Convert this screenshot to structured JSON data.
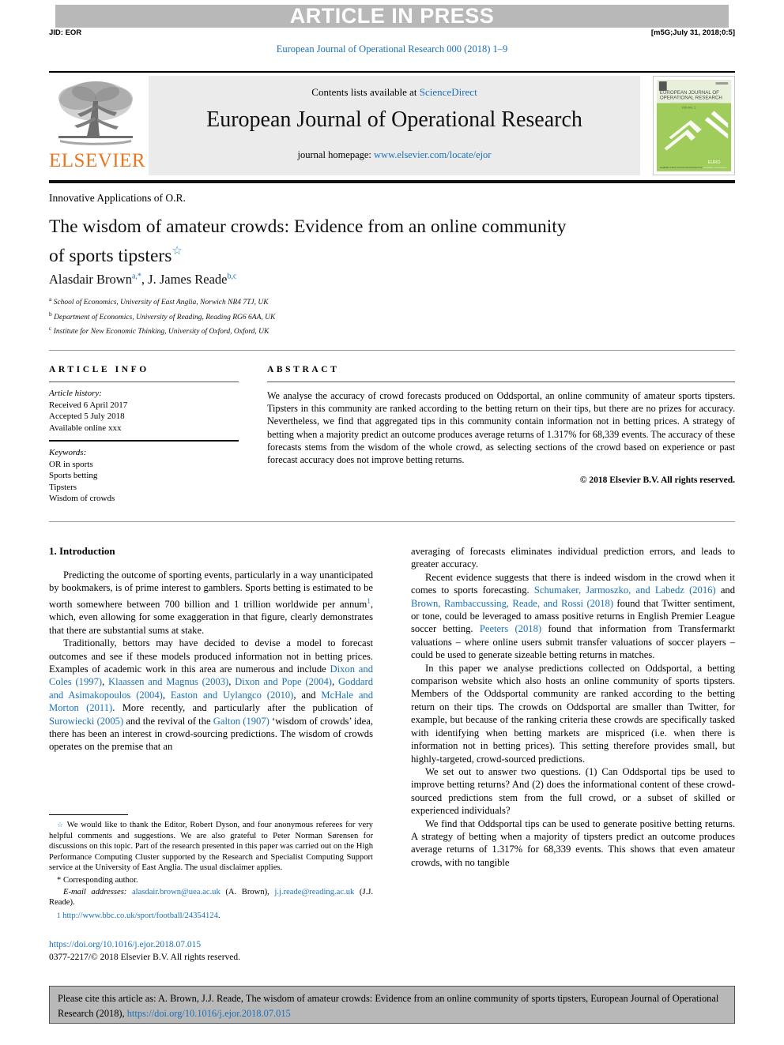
{
  "banner": {
    "text": "ARTICLE IN PRESS"
  },
  "marker": {
    "jid": "JID: EOR",
    "tag": "[m5G;July 31, 2018;0:5]"
  },
  "running_head": "European Journal of Operational Research 000 (2018) 1–9",
  "masthead": {
    "contents_prefix": "Contents lists available at ",
    "contents_link": "ScienceDirect",
    "journal_title": "European Journal of Operational Research",
    "homepage_prefix": "journal homepage: ",
    "homepage_url": "www.elsevier.com/locate/ejor",
    "publisher_wordmark": "ELSEVIER",
    "cover_title_line1": "EUROPEAN JOURNAL OF",
    "cover_title_line2": "OPERATIONAL RESEARCH",
    "cover_volume": "Volume 1",
    "cover_footer": "EURO"
  },
  "article": {
    "kicker": "Innovative Applications of O.R.",
    "title_line1": "The wisdom of amateur crowds: Evidence from an online community",
    "title_line2": "of sports tipsters",
    "title_star": "☆",
    "authors_html": "Alasdair Brown",
    "author1": "Alasdair Brown",
    "author1_sup": "a,*",
    "author2": "J. James Reade",
    "author2_sup": "b,c",
    "affiliations": [
      {
        "mark": "a",
        "text": "School of Economics, University of East Anglia, Norwich NR4 7TJ, UK"
      },
      {
        "mark": "b",
        "text": "Department of Economics, University of Reading, Reading RG6 6AA, UK"
      },
      {
        "mark": "c",
        "text": "Institute for New Economic Thinking, University of Oxford, Oxford, UK"
      }
    ]
  },
  "article_info": {
    "heading": "ARTICLE INFO",
    "history_label": "Article history:",
    "history": [
      "Received 6 April 2017",
      "Accepted 5 July 2018",
      "Available online xxx"
    ],
    "keywords_label": "Keywords:",
    "keywords": [
      "OR in sports",
      "Sports betting",
      "Tipsters",
      "Wisdom of crowds"
    ]
  },
  "abstract": {
    "heading": "ABSTRACT",
    "text": "We analyse the accuracy of crowd forecasts produced on Oddsportal, an online community of amateur sports tipsters. Tipsters in this community are ranked according to the betting return on their tips, but there are no prizes for accuracy. Nevertheless, we find that aggregated tips in this community contain information not in betting prices. A strategy of betting when a majority predict an outcome produces average returns of 1.317% for 68,339 events. The accuracy of these forecasts stems from the wisdom of the whole crowd, as selecting sections of the crowd based on experience or past forecast accuracy does not improve betting returns.",
    "copyright": "© 2018 Elsevier B.V. All rights reserved."
  },
  "body": {
    "section_title": "1. Introduction",
    "left_p1_a": "Predicting the outcome of sporting events, particularly in a way unanticipated by bookmakers, is of prime interest to gamblers. Sports betting is estimated to be worth somewhere between 700 billion and 1 trillion worldwide per annum",
    "left_p1_fn": "1",
    "left_p1_b": ", which, even allowing for some exaggeration in that figure, clearly demonstrates that there are substantial sums at stake.",
    "left_p2_a": "Traditionally, bettors may have decided to devise a model to forecast outcomes and see if these models produced information not in betting prices. Examples of academic work in this area are numerous and include ",
    "left_p2_cite1": "Dixon and Coles (1997)",
    "left_p2_s1": ", ",
    "left_p2_cite2": "Klaassen and Magnus (2003)",
    "left_p2_s2": ", ",
    "left_p2_cite3": "Dixon and Pope (2004)",
    "left_p2_s3": ", ",
    "left_p2_cite4": "Goddard and Asimakopoulos (2004)",
    "left_p2_s4": ", ",
    "left_p2_cite5": "Easton and Uylangco (2010)",
    "left_p2_s5": ", and ",
    "left_p2_cite6": "McHale and Morton (2011)",
    "left_p2_s6": ". More recently, and particularly after the publication of ",
    "left_p2_cite7": "Surowiecki (2005)",
    "left_p2_s7": " and the revival of the ",
    "left_p2_cite8": "Galton (1907)",
    "left_p2_s8": " ‘wisdom of crowds’ idea, there has been an interest in crowd-sourcing predictions. The wisdom of crowds operates on the premise that an",
    "right_p1": "averaging of forecasts eliminates individual prediction errors, and leads to greater accuracy.",
    "right_p2_a": "Recent evidence suggests that there is indeed wisdom in the crowd when it comes to sports forecasting. ",
    "right_p2_cite1": "Schumaker, Jarmoszko, and Labedz (2016)",
    "right_p2_s1": " and ",
    "right_p2_cite2": "Brown, Rambaccussing, Reade, and Rossi (2018)",
    "right_p2_s2": " found that Twitter sentiment, or tone, could be leveraged to amass positive returns in English Premier League soccer betting. ",
    "right_p2_cite3": "Peeters (2018)",
    "right_p2_s3": " found that information from Transfermarkt valuations – where online users submit transfer valuations of soccer players – could be used to generate sizeable betting returns in matches.",
    "right_p3": "In this paper we analyse predictions collected on Oddsportal, a betting comparison website which also hosts an online community of sports tipsters. Members of the Oddsportal community are ranked according to the betting return on their tips. The crowds on Oddsportal are smaller than Twitter, for example, but because of the ranking criteria these crowds are specifically tasked with identifying when betting markets are mispriced (i.e. when there is information not in betting prices). This setting therefore provides small, but highly-targeted, crowd-sourced predictions.",
    "right_p4": "We set out to answer two questions. (1) Can Oddsportal tips be used to improve betting returns? And (2) does the informational content of these crowd-sourced predictions stem from the full crowd, or a subset of skilled or experienced individuals?",
    "right_p5": "We find that Oddsportal tips can be used to generate positive betting returns. A strategy of betting when a majority of tipsters predict an outcome produces average returns of 1.317% for 68,339 events. This shows that even amateur crowds, with no tangible"
  },
  "footnotes": {
    "star_mark": "☆",
    "star_text": "We would like to thank the Editor, Robert Dyson, and four anonymous referees for very helpful comments and suggestions. We are also grateful to Peter Norman Sørensen for discussions on this topic. Part of the research presented in this paper was carried out on the High Performance Computing Cluster supported by the Research and Specialist Computing Support service at the University of East Anglia. The usual disclaimer applies.",
    "corr_mark": "*",
    "corr_text": "Corresponding author.",
    "email_label": "E-mail addresses:",
    "email1": "alasdair.brown@uea.ac.uk",
    "email1_owner": "(A. Brown),",
    "email2": "j.j.reade@reading.ac.uk",
    "email2_owner": "(J.J. Reade).",
    "num_mark": "1",
    "num_link": "http://www.bbc.co.uk/sport/football/24354124",
    "num_tail": "."
  },
  "footer": {
    "doi": "https://doi.org/10.1016/j.ejor.2018.07.015",
    "issn": "0377-2217/© 2018 Elsevier B.V. All rights reserved."
  },
  "cite_box": {
    "text_before": "Please cite this article as: A. Brown, J.J. Reade, The wisdom of amateur crowds: Evidence from an online community of sports tipsters, European Journal of Operational Research (2018), ",
    "link": "https://doi.org/10.1016/j.ejor.2018.07.015"
  },
  "colors": {
    "link": "#1a70b8",
    "banner_bg": "#b8b8b8",
    "elsevier_orange": "#e87722",
    "masthead_bg": "#ebebeb",
    "cover_green": "#8dc63f"
  }
}
